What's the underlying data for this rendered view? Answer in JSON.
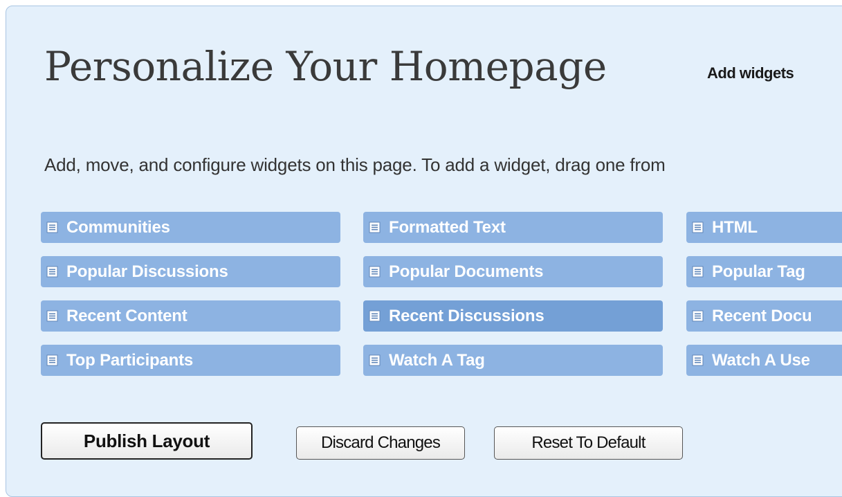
{
  "page": {
    "title": "Personalize Your Homepage",
    "add_widgets_link": "Add widgets",
    "instructions": "Add, move, and configure widgets on this page. To add a widget, drag one from"
  },
  "widgets": [
    {
      "label": "Communities",
      "icon": "widget-icon"
    },
    {
      "label": "Formatted Text",
      "icon": "widget-icon"
    },
    {
      "label": "HTML",
      "icon": "widget-icon"
    },
    {
      "label": "Popular Discussions",
      "icon": "widget-icon"
    },
    {
      "label": "Popular Documents",
      "icon": "widget-icon"
    },
    {
      "label": "Popular Tag",
      "icon": "widget-icon"
    },
    {
      "label": "Recent Content",
      "icon": "widget-icon"
    },
    {
      "label": "Recent Discussions",
      "icon": "widget-icon"
    },
    {
      "label": "Recent Docu",
      "icon": "widget-icon"
    },
    {
      "label": "Top Participants",
      "icon": "widget-icon"
    },
    {
      "label": "Watch A Tag",
      "icon": "widget-icon"
    },
    {
      "label": "Watch A Use",
      "icon": "widget-icon"
    }
  ],
  "buttons": {
    "publish": "Publish Layout",
    "discard": "Discard Changes",
    "reset": "Reset To Default"
  },
  "colors": {
    "panel_background": "#e4f0fb",
    "widget_background": "#8db3e2",
    "widget_active_background": "#74a0d6",
    "widget_text": "#ffffff"
  }
}
